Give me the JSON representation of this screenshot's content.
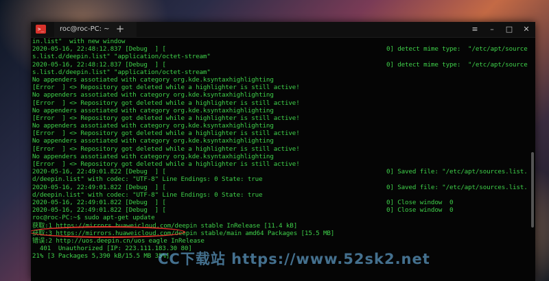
{
  "window": {
    "tab_title": "roc@roc-PC: ~",
    "app_icon_glyph": ">_",
    "new_tab": "+",
    "controls": {
      "menu": "≡",
      "minimize": "–",
      "maximize": "□",
      "close": "✕"
    }
  },
  "terminal": {
    "lines": [
      {
        "left": "in.list\"  with new window",
        "right": ""
      },
      {
        "left": "2020-05-16, 22:48:12.837 [Debug  ] [",
        "right": "0] detect mime type:  \"/etc/apt/source"
      },
      {
        "left": "s.list.d/deepin.list\" \"application/octet-stream\"",
        "right": ""
      },
      {
        "left": "2020-05-16, 22:48:12.837 [Debug  ] [",
        "right": "0] detect mime type:  \"/etc/apt/source"
      },
      {
        "left": "s.list.d/deepin.list\" \"application/octet-stream\"",
        "right": ""
      },
      {
        "left": "No appenders assotiated with category org.kde.ksyntaxhighlighting",
        "right": ""
      },
      {
        "left": "[Error  ] <> Repository got deleted while a highlighter is still active!",
        "right": ""
      },
      {
        "left": "No appenders assotiated with category org.kde.ksyntaxhighlighting",
        "right": ""
      },
      {
        "left": "[Error  ] <> Repository got deleted while a highlighter is still active!",
        "right": ""
      },
      {
        "left": "No appenders assotiated with category org.kde.ksyntaxhighlighting",
        "right": ""
      },
      {
        "left": "[Error  ] <> Repository got deleted while a highlighter is still active!",
        "right": ""
      },
      {
        "left": "No appenders assotiated with category org.kde.ksyntaxhighlighting",
        "right": ""
      },
      {
        "left": "[Error  ] <> Repository got deleted while a highlighter is still active!",
        "right": ""
      },
      {
        "left": "No appenders assotiated with category org.kde.ksyntaxhighlighting",
        "right": ""
      },
      {
        "left": "[Error  ] <> Repository got deleted while a highlighter is still active!",
        "right": ""
      },
      {
        "left": "No appenders assotiated with category org.kde.ksyntaxhighlighting",
        "right": ""
      },
      {
        "left": "[Error  ] <> Repository got deleted while a highlighter is still active!",
        "right": ""
      },
      {
        "left": "2020-05-16, 22:49:01.822 [Debug  ] [",
        "right": "0] Saved file: \"/etc/apt/sources.list."
      },
      {
        "left": "d/deepin.list\" with codec: \"UTF-8\" Line Endings: 0 State: true",
        "right": ""
      },
      {
        "left": "2020-05-16, 22:49:01.822 [Debug  ] [",
        "right": "0] Saved file: \"/etc/apt/sources.list."
      },
      {
        "left": "d/deepin.list\" with codec: \"UTF-8\" Line Endings: 0 State: true",
        "right": ""
      },
      {
        "left": "2020-05-16, 22:49:01.822 [Debug  ] [",
        "right": "0] Close window  0"
      },
      {
        "left": "2020-05-16, 22:49:01.822 [Debug  ] [",
        "right": "0] Close window  0"
      },
      {
        "left": "roc@roc-PC:~$ sudo apt-get update",
        "right": ""
      },
      {
        "left": "获取:1 https://mirrors.huaweicloud.com/deepin stable InRelease [11.4 kB]",
        "right": ""
      },
      {
        "left": "获取:3 https://mirrors.huaweicloud.com/deepin stable/main amd64 Packages [15.5 MB]",
        "right": ""
      },
      {
        "left": "错误:2 http://uos.deepin.cn/uos eagle InRelease",
        "right": ""
      },
      {
        "left": "  401  Unauthorized [IP: 223.111.183.30 80]",
        "right": ""
      },
      {
        "left": "21% [3 Packages 5,390 kB/15.5 MB 35%]",
        "right": ""
      }
    ]
  },
  "watermark": "CC下载站 https://www.52sk2.net",
  "colors": {
    "terminal_text": "#3fd14a",
    "highlight_oval": "#e3342b",
    "terminal_bg": "#050505"
  }
}
